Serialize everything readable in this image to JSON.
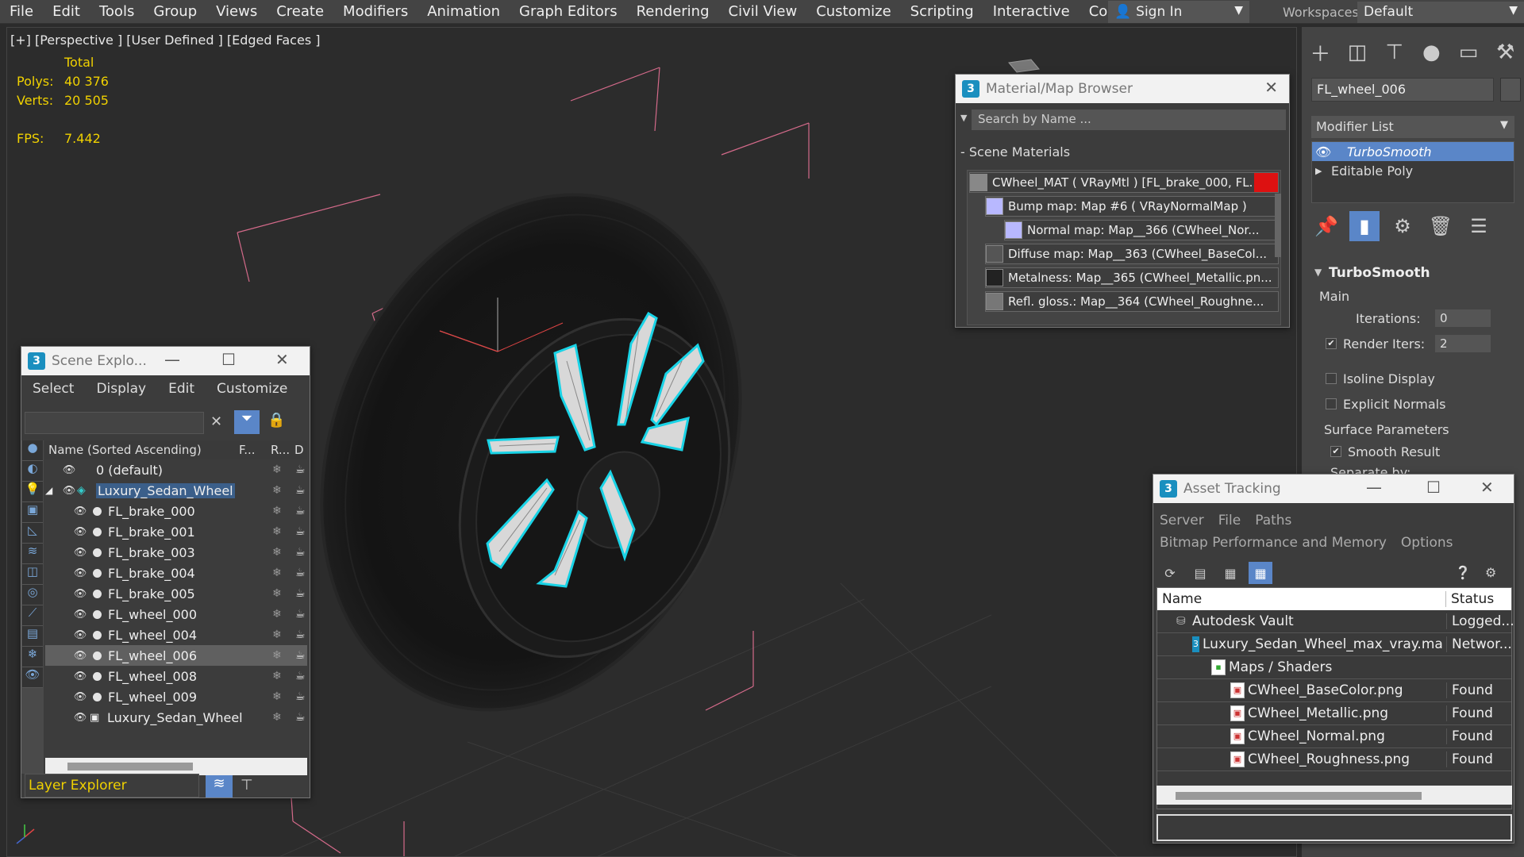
{
  "menubar": {
    "items": [
      "File",
      "Edit",
      "Tools",
      "Group",
      "Views",
      "Create",
      "Modifiers",
      "Animation",
      "Graph Editors",
      "Rendering",
      "Civil View",
      "Customize",
      "Scripting",
      "Interactive",
      "Content"
    ],
    "more": "»",
    "sign_in": "Sign In",
    "workspaces_label": "Workspaces:",
    "workspace_value": "Default"
  },
  "viewport": {
    "label": "[+] [Perspective ] [User Defined ] [Edged Faces ]",
    "stats_header": "Total",
    "polys_label": "Polys:",
    "polys_value": "40 376",
    "verts_label": "Verts:",
    "verts_value": "20 505",
    "fps_label": "FPS:",
    "fps_value": "7.442"
  },
  "command_panel": {
    "object_name": "FL_wheel_006",
    "modifier_list_label": "Modifier List",
    "stack": [
      "TurboSmooth",
      "Editable Poly"
    ],
    "rollout_title": "TurboSmooth",
    "main_label": "Main",
    "iterations_label": "Iterations:",
    "iterations_value": "0",
    "render_iters_label": "Render Iters:",
    "render_iters_value": "2",
    "isoline_label": "Isoline Display",
    "explicit_normals_label": "Explicit Normals",
    "surface_params_label": "Surface Parameters",
    "smooth_result_label": "Smooth Result",
    "separate_by_label": "Separate by:"
  },
  "material_browser": {
    "title": "Material/Map Browser",
    "search_placeholder": "Search by Name ...",
    "section": "Scene Materials",
    "items": [
      "CWheel_MAT  ( VRayMtl )  [FL_brake_000, FL...",
      "Bump map: Map #6  ( VRayNormalMap )",
      "Normal  map:  Map__366 (CWheel_Nor...",
      "Diffuse  map:  Map__363  (CWheel_BaseCol...",
      "Metalness:  Map__365  (CWheel_Metallic.pn...",
      "Refl.  gloss.:  Map__364  (CWheel_Roughne..."
    ]
  },
  "scene_explorer": {
    "title": "Scene Explo...",
    "menu": [
      "Select",
      "Display",
      "Edit",
      "Customize"
    ],
    "column_name": "Name (Sorted Ascending)",
    "column_f": "F...",
    "column_r": "R...",
    "column_d": "D",
    "rows": [
      {
        "name": "0 (default)",
        "indent": 0
      },
      {
        "name": "Luxury_Sedan_Wheel",
        "indent": 0
      },
      {
        "name": "FL_brake_000",
        "indent": 1
      },
      {
        "name": "FL_brake_001",
        "indent": 1
      },
      {
        "name": "FL_brake_003",
        "indent": 1
      },
      {
        "name": "FL_brake_004",
        "indent": 1
      },
      {
        "name": "FL_brake_005",
        "indent": 1
      },
      {
        "name": "FL_wheel_000",
        "indent": 1
      },
      {
        "name": "FL_wheel_004",
        "indent": 1
      },
      {
        "name": "FL_wheel_006",
        "indent": 1
      },
      {
        "name": "FL_wheel_008",
        "indent": 1
      },
      {
        "name": "FL_wheel_009",
        "indent": 1
      },
      {
        "name": "Luxury_Sedan_Wheel",
        "indent": 1
      }
    ],
    "footer_label": "Layer Explorer"
  },
  "asset_tracking": {
    "title": "Asset Tracking",
    "menu_row1": [
      "Server",
      "File",
      "Paths"
    ],
    "menu_row2": [
      "Bitmap Performance and Memory",
      "Options"
    ],
    "col_name": "Name",
    "col_status": "Status",
    "rows": [
      {
        "name": "Autodesk Vault",
        "status": "Logged..."
      },
      {
        "name": "Luxury_Sedan_Wheel_max_vray.max",
        "status": "Networ..."
      },
      {
        "name": "Maps / Shaders",
        "status": ""
      },
      {
        "name": "CWheel_BaseColor.png",
        "status": "Found"
      },
      {
        "name": "CWheel_Metallic.png",
        "status": "Found"
      },
      {
        "name": "CWheel_Normal.png",
        "status": "Found"
      },
      {
        "name": "CWheel_Roughness.png",
        "status": "Found"
      }
    ]
  },
  "colors": {
    "accent": "#5a86c8",
    "stats_yellow": "#f0d100",
    "selection_cyan": "#19d3e6",
    "bbox_pink": "#d46a8a"
  }
}
